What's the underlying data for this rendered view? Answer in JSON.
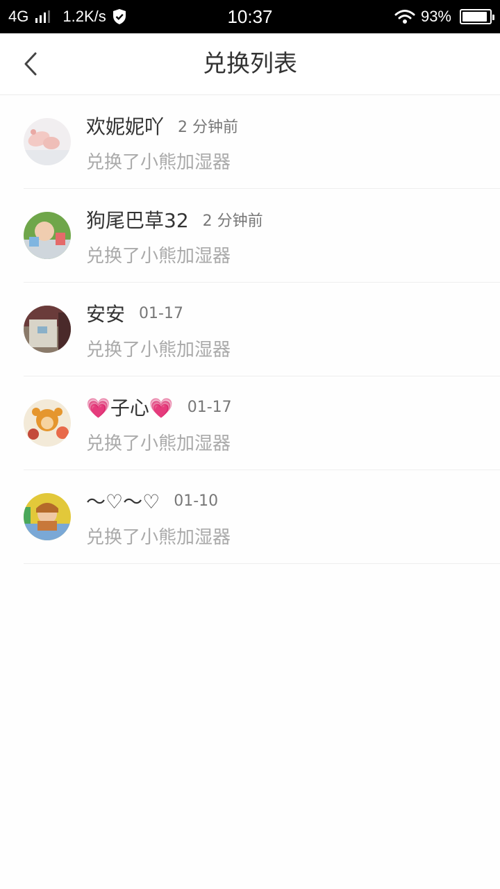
{
  "status_bar": {
    "network": "4G",
    "speed": "1.2K/s",
    "time": "10:37",
    "battery": "93%",
    "battery_level": 0.93
  },
  "header": {
    "title": "兑换列表"
  },
  "items": [
    {
      "name": "欢妮妮吖",
      "time": "2 分钟前",
      "desc": "兑换了小熊加湿器"
    },
    {
      "name": "狗尾巴草32",
      "time": "2 分钟前",
      "desc": "兑换了小熊加湿器"
    },
    {
      "name": "安安",
      "time": "01-17",
      "desc": "兑换了小熊加湿器"
    },
    {
      "name": "💗子心💗",
      "time": "01-17",
      "desc": "兑换了小熊加湿器"
    },
    {
      "name": "～♡～♡",
      "time": "01-10",
      "desc": "兑换了小熊加湿器"
    }
  ]
}
